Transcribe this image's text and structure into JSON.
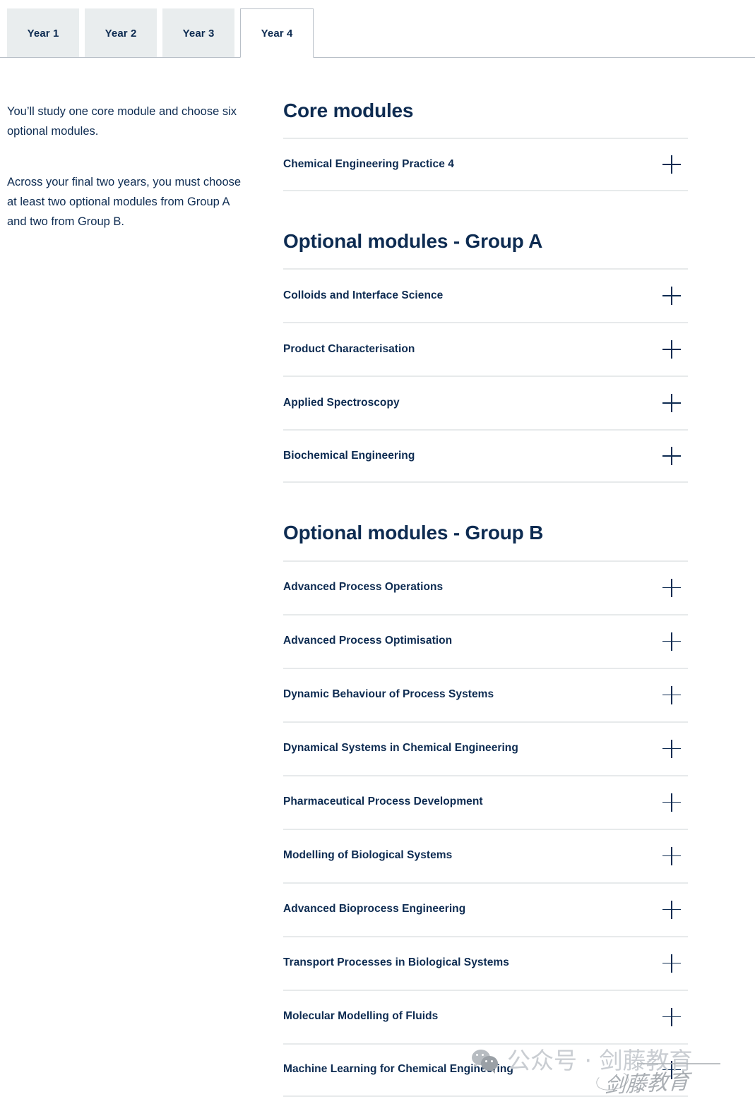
{
  "tabs": [
    {
      "label": "Year 1",
      "active": false
    },
    {
      "label": "Year 2",
      "active": false
    },
    {
      "label": "Year 3",
      "active": false
    },
    {
      "label": "Year 4",
      "active": true
    }
  ],
  "intro": {
    "paragraph_1": "You’ll study one core module and choose six optional modules.",
    "paragraph_2": "Across your final two years, you must choose at least two optional modules from Group A and two from Group B."
  },
  "sections": [
    {
      "heading": "Core modules",
      "modules": [
        "Chemical Engineering Practice 4"
      ]
    },
    {
      "heading": "Optional modules - Group A",
      "modules": [
        "Colloids and Interface Science",
        "Product Characterisation",
        "Applied Spectroscopy",
        "Biochemical Engineering"
      ]
    },
    {
      "heading": "Optional modules - Group B",
      "modules": [
        "Advanced Process Operations",
        "Advanced Process Optimisation",
        "Dynamic Behaviour of Process Systems",
        "Dynamical Systems in Chemical Engineering",
        "Pharmaceutical Process Development",
        "Modelling of Biological Systems",
        "Advanced Bioprocess Engineering",
        "Transport Processes in Biological Systems",
        "Molecular Modelling of Fluids",
        "Machine Learning for Chemical Engineering"
      ]
    }
  ],
  "icons": {
    "expand": "plus-icon",
    "wechat": "wechat-logo-icon"
  },
  "watermark": {
    "text": "公众号 · 剑藤教育",
    "signature": "剑藤教育"
  },
  "colors": {
    "text_navy": "#0d2b51",
    "tab_inactive_bg": "#e9edee",
    "tab_active_bg": "#ffffff",
    "divider": "#e7eaeb",
    "strip_rule": "#b9c0c8",
    "watermark_grey": "#c9cdd2"
  }
}
